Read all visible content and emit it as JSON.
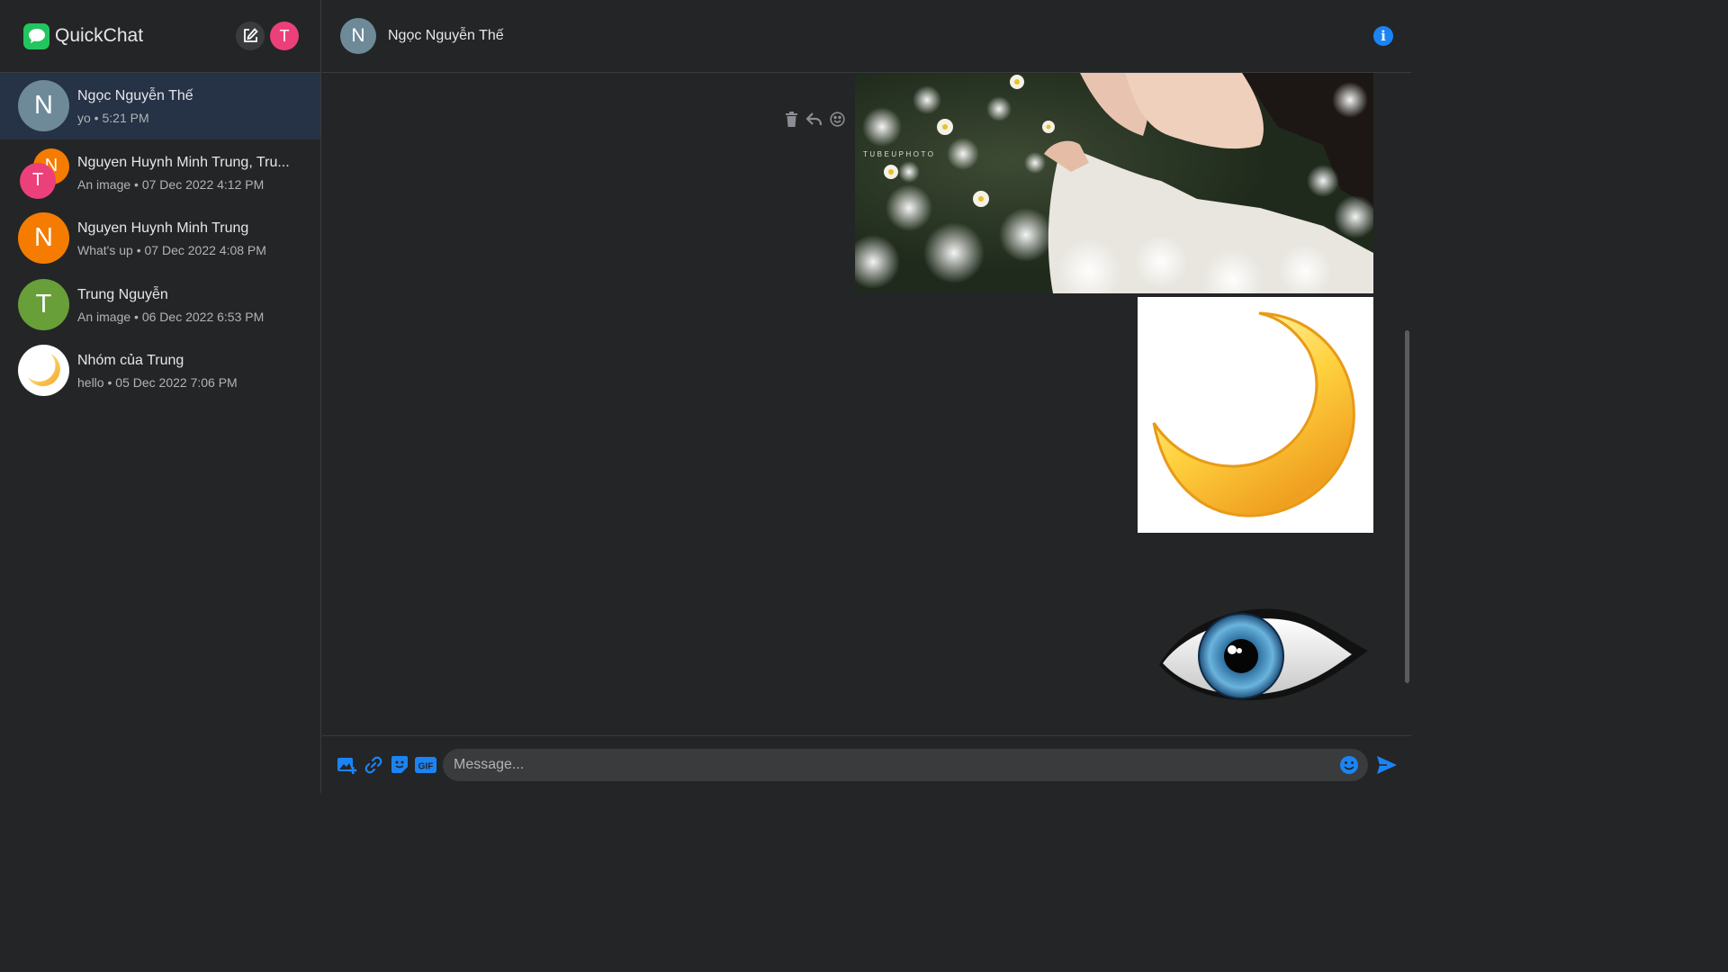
{
  "app": {
    "title": "QuickChat"
  },
  "me": {
    "initial": "T",
    "color": "#ec407a"
  },
  "conversations": [
    {
      "name": "Ngọc Nguyễn Thế",
      "last": "yo",
      "time": "5:21 PM",
      "initial": "N",
      "color": "#6e8a99",
      "active": true
    },
    {
      "name": "Nguyen Huynh Minh Trung, Tru...",
      "last": "An image",
      "time": "07 Dec 2022 4:12 PM",
      "initial": "N",
      "initial2": "T",
      "color": "#f57c00",
      "color2": "#ec407a",
      "group": true
    },
    {
      "name": "Nguyen Huynh Minh Trung",
      "last": "What's up",
      "time": "07 Dec 2022 4:08 PM",
      "initial": "N",
      "color": "#f57c00"
    },
    {
      "name": "Trung Nguyễn",
      "last": "An image",
      "time": "06 Dec 2022 6:53 PM",
      "initial": "T",
      "color": "#689f38"
    },
    {
      "name": "Nhóm của Trung",
      "last": "hello",
      "time": "05 Dec 2022 7:06 PM",
      "icon": "crescent-moon-icon"
    }
  ],
  "chat": {
    "name": "Ngọc Nguyễn Thế",
    "initial": "N",
    "color": "#6e8a99",
    "photo_watermark": "TUBEUPHOTO"
  },
  "composer": {
    "placeholder": "Message...",
    "gif_label": "GIF"
  },
  "colors": {
    "accent": "#1b84f5",
    "active_row": "#263245",
    "background": "#242526"
  }
}
